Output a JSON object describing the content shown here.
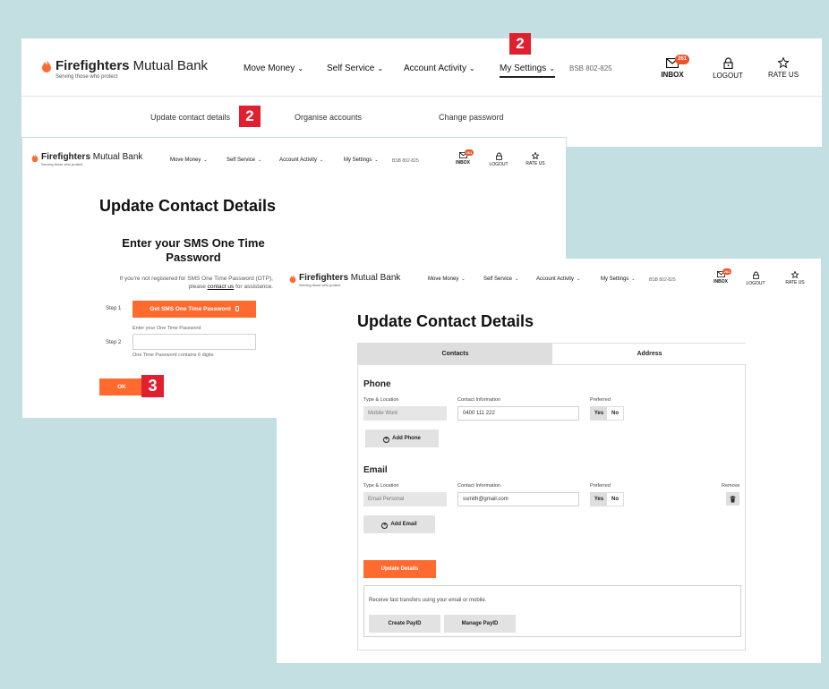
{
  "brand": {
    "name_bold": "Firefighters",
    "name_light": " Mutual Bank",
    "tagline": "Serving those who protect"
  },
  "nav": {
    "items": [
      "Move Money",
      "Self Service",
      "Account Activity",
      "My Settings"
    ],
    "chevron": "⌄",
    "bsb": "BSB 802-825",
    "inbox_label": "INBOX",
    "inbox_count": "261",
    "logout_label": "LOGOUT",
    "rate_label": "RATE US"
  },
  "submenu": {
    "items": [
      "Update contact details",
      "Organise accounts",
      "Change password"
    ]
  },
  "markers": {
    "settings": "2",
    "update_contact": "2",
    "ok": "3"
  },
  "otp_page": {
    "title": "Update Contact Details",
    "subtitle": "Enter your SMS One Time Password",
    "help_prefix": "If you're not registered for SMS One Time Password (OTP), please",
    "help_link": "contact us",
    "help_suffix": "for assistance.",
    "step1_label": "Step 1",
    "get_otp_button": "Get SMS One Time Password",
    "otp_field_label": "Enter your One Time Password",
    "step2_label": "Step 2",
    "otp_value": "",
    "otp_hint": "One Time Password contains 6 digits",
    "ok_button": "OK"
  },
  "contact_page": {
    "title": "Update Contact Details",
    "tabs": [
      "Contacts",
      "Address"
    ],
    "phone_heading": "Phone",
    "email_heading": "Email",
    "col_type": "Type & Location",
    "col_info": "Contact Information",
    "col_pref": "Preferred",
    "col_remove": "Remove",
    "phone_type": "Mobile Work",
    "phone_value": "0400 111 222",
    "email_type": "Email Personal",
    "email_value": "ssmith@gmail.com",
    "yes": "Yes",
    "no": "No",
    "add_phone": "Add Phone",
    "add_email": "Add Email",
    "update_button": "Update Details",
    "payid_text": "Receive fast transfers using your email or mobile.",
    "create_payid": "Create PayID",
    "manage_payid": "Manage PayID"
  },
  "colors": {
    "background": "#c3dfe2",
    "accent_orange": "#ff6a2f",
    "marker_red": "#e0202e"
  }
}
